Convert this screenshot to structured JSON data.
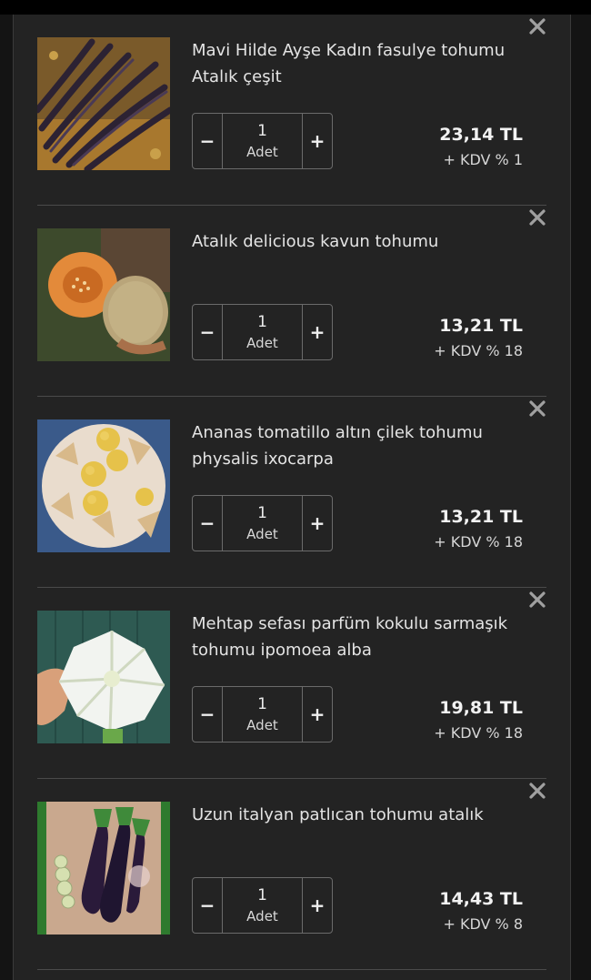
{
  "cart": {
    "items": [
      {
        "title": "Mavi Hilde Ayşe Kadın fasulye tohumu Atalık çeşit",
        "image": "purple-beans-photo",
        "quantity": "1",
        "unit": "Adet",
        "price": "23,14 TL",
        "vat": "+ KDV % 1"
      },
      {
        "title": "Atalık delicious kavun tohumu",
        "image": "cantaloupe-photo",
        "quantity": "1",
        "unit": "Adet",
        "price": "13,21 TL",
        "vat": "+ KDV % 18"
      },
      {
        "title": "Ananas tomatillo altın çilek tohumu physalis ixocarpa",
        "image": "physalis-photo",
        "quantity": "1",
        "unit": "Adet",
        "price": "13,21 TL",
        "vat": "+ KDV % 18"
      },
      {
        "title": "Mehtap sefası parfüm kokulu sarmaşık tohumu ipomoea alba",
        "image": "moonflower-photo",
        "quantity": "1",
        "unit": "Adet",
        "price": "19,81 TL",
        "vat": "+ KDV % 18"
      },
      {
        "title": "Uzun italyan patlıcan tohumu atalık",
        "image": "eggplant-photo",
        "quantity": "1",
        "unit": "Adet",
        "price": "14,43 TL",
        "vat": "+ KDV % 8"
      }
    ],
    "controls": {
      "minus": "−",
      "plus": "+"
    },
    "icons": {
      "remove": "close-icon"
    },
    "colors": {
      "background": "#232323",
      "text": "#e4e4e4",
      "border": "#6b6b6b"
    }
  }
}
